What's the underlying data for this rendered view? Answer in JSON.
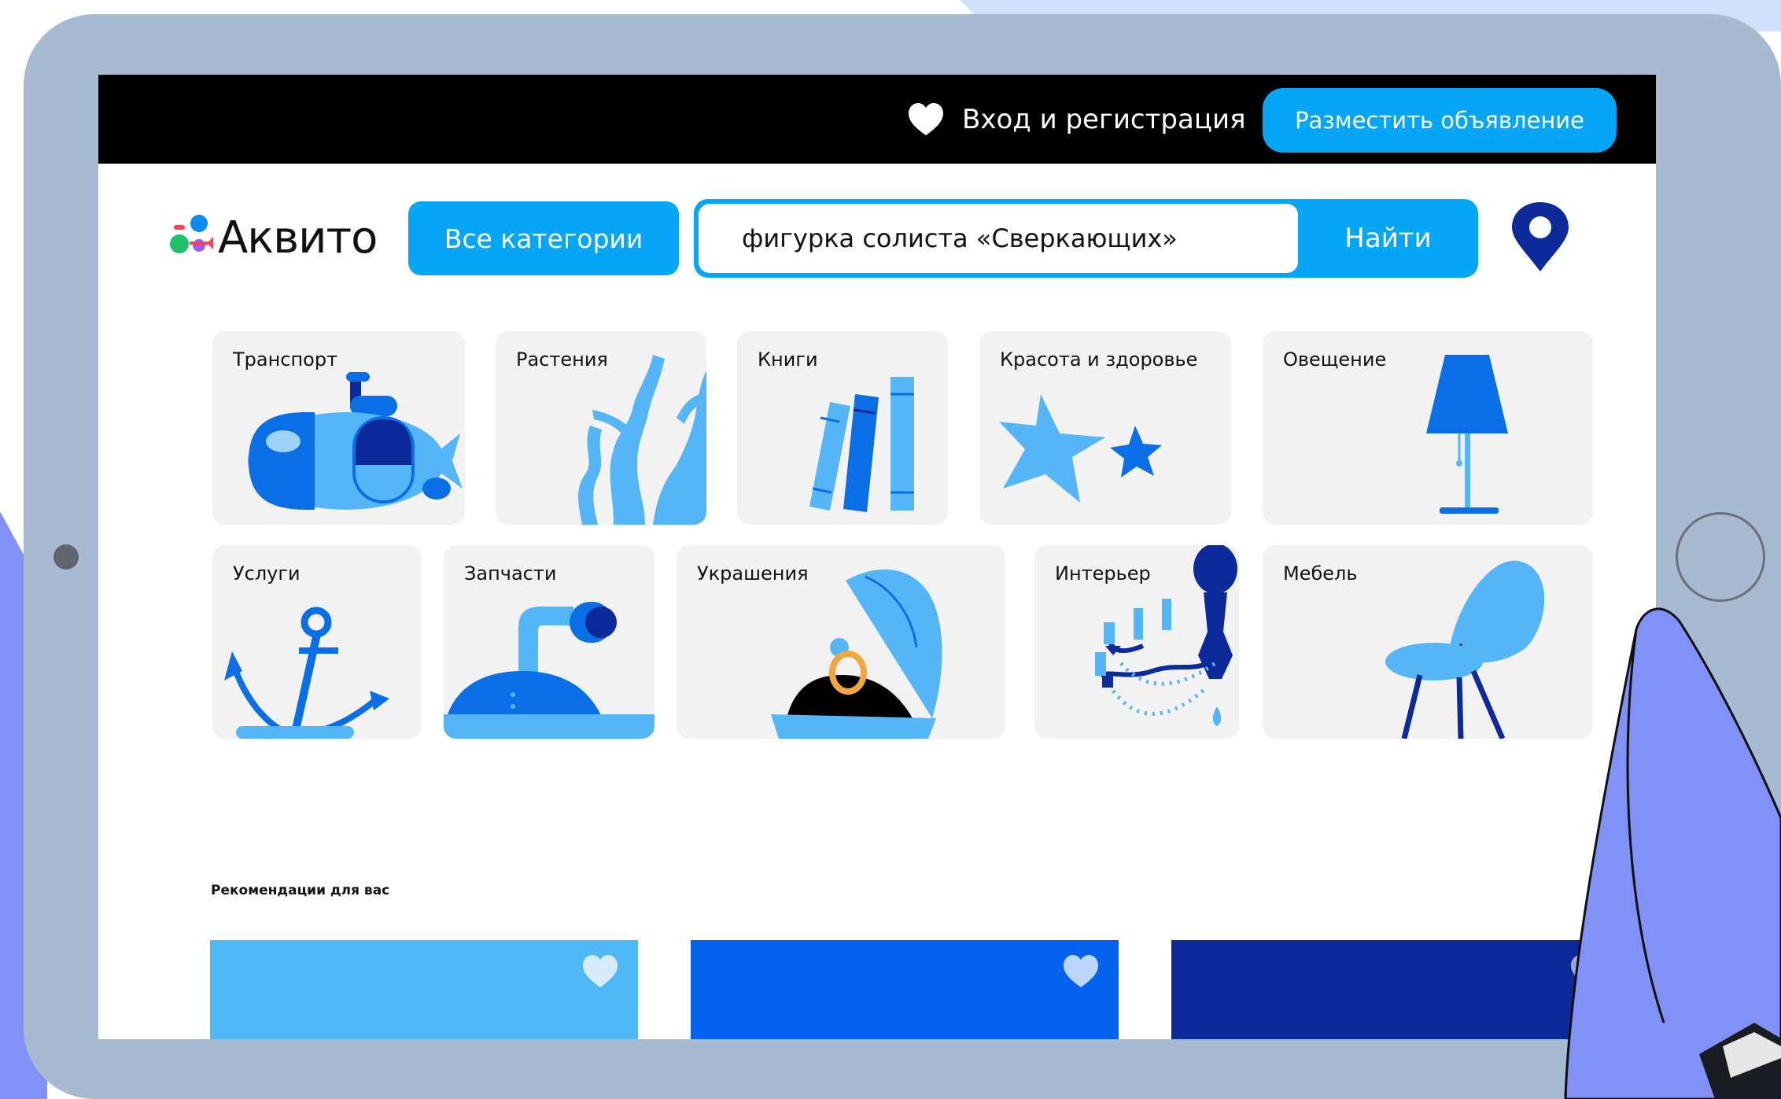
{
  "topbar": {
    "login_label": "Вход и регистрация",
    "post_label": "Разместить объявление"
  },
  "brand": {
    "name": "Аквито"
  },
  "search": {
    "category_label": "Все категории",
    "query": "фигурка солиста «Сверкающих»",
    "submit_label": "Найти"
  },
  "categories": [
    {
      "label": "Транспорт",
      "icon": "submarine-icon"
    },
    {
      "label": "Растения",
      "icon": "coral-icon"
    },
    {
      "label": "Книги",
      "icon": "books-icon"
    },
    {
      "label": "Красота и здоровье",
      "icon": "starfish-icon"
    },
    {
      "label": "Овещение",
      "icon": "lamp-icon"
    },
    {
      "label": "Услуги",
      "icon": "anchor-icon"
    },
    {
      "label": "Запчасти",
      "icon": "periscope-icon"
    },
    {
      "label": "Украшения",
      "icon": "shell-ring-icon"
    },
    {
      "label": "Интерьер",
      "icon": "chandelier-icon"
    },
    {
      "label": "Мебель",
      "icon": "chair-icon"
    }
  ],
  "recommendations": {
    "title": "Рекомендации для вас",
    "cards": [
      {
        "color": "#4fb8f7"
      },
      {
        "color": "#0363ee"
      },
      {
        "color": "#0c2a9a"
      }
    ]
  },
  "colors": {
    "accent": "#04a6f5",
    "tablet_frame": "#a6bbd1",
    "card_bg": "#f2f2f2",
    "illustration_light": "#55b6f7",
    "illustration_mid": "#0a6fe6",
    "illustration_dark": "#0c2a9a"
  }
}
